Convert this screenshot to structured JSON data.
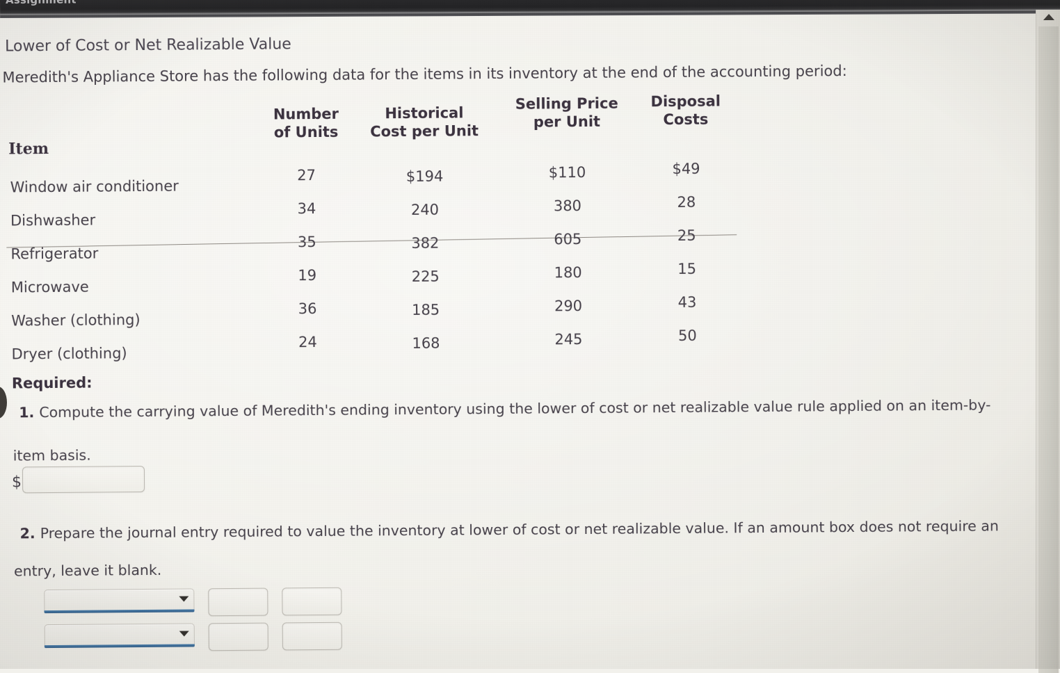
{
  "browser": {
    "tab_title_partial": "Assignment"
  },
  "scrollbar": {
    "up_arrow_icon": "triangle-up-icon"
  },
  "document": {
    "title": "Lower of Cost or Net Realizable Value",
    "intro": "Meredith's Appliance Store has the following data for the items in its inventory at the end of the accounting period:"
  },
  "table": {
    "headers": {
      "item": "Item",
      "units_line1": "Number",
      "units_line2": "of Units",
      "cost_line1": "Historical",
      "cost_line2": "Cost per Unit",
      "selling_line1": "Selling Price",
      "selling_line2": "per Unit",
      "disposal_line1": "Disposal",
      "disposal_line2": "Costs"
    },
    "rows": [
      {
        "item": "Window air conditioner",
        "units": "27",
        "cost": "$194",
        "selling": "$110",
        "disposal": "$49"
      },
      {
        "item": "Dishwasher",
        "units": "34",
        "cost": "240",
        "selling": "380",
        "disposal": "28"
      },
      {
        "item": "Refrigerator",
        "units": "35",
        "cost": "382",
        "selling": "605",
        "disposal": "25"
      },
      {
        "item": "Microwave",
        "units": "19",
        "cost": "225",
        "selling": "180",
        "disposal": "15"
      },
      {
        "item": "Washer (clothing)",
        "units": "36",
        "cost": "185",
        "selling": "290",
        "disposal": "43"
      },
      {
        "item": "Dryer (clothing)",
        "units": "24",
        "cost": "168",
        "selling": "245",
        "disposal": "50"
      }
    ]
  },
  "required": {
    "label": "Required:",
    "q1": {
      "number": "1.",
      "line1": "Compute the carrying value of Meredith's ending inventory using the lower of cost or net realizable value rule applied on an item-by-",
      "line2": "item basis.",
      "dollar_prefix": "$",
      "answer_value": "",
      "answer_placeholder": ""
    },
    "q2": {
      "number": "2.",
      "line1": "Prepare the journal entry required to value the inventory at lower of cost or net realizable value. If an amount box does not require an",
      "line2": "entry, leave it blank."
    }
  },
  "journal": {
    "rows": [
      {
        "account_selected": "",
        "account_options": [
          ""
        ],
        "debit_value": "",
        "credit_value": "",
        "dropdown_icon": "chevron-down-icon"
      },
      {
        "account_selected": "",
        "account_options": [
          ""
        ],
        "debit_value": "",
        "credit_value": "",
        "dropdown_icon": "chevron-down-icon"
      }
    ]
  },
  "colors": {
    "page_background": "#f2f1ec",
    "text": "#46414a",
    "heading": "#3c3340",
    "rule": "#8f8a84",
    "select_underline": "#35618c",
    "chrome": "#242426"
  }
}
